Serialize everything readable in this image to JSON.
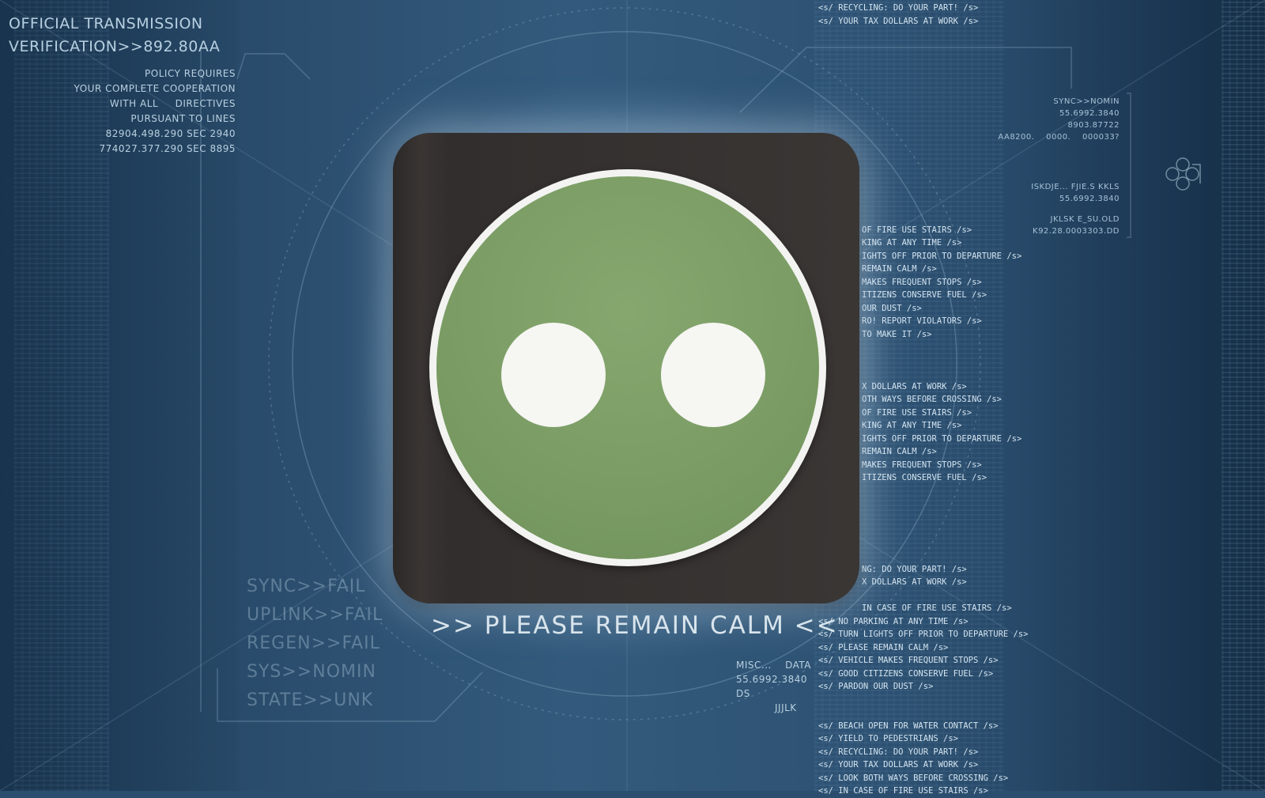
{
  "header": {
    "line1": "OFFICIAL TRANSMISSION",
    "line2": "VERIFICATION>>892.80AA"
  },
  "policy": [
    "POLICY REQUIRES",
    "YOUR COMPLETE COOPERATION",
    "WITH ALL     DIRECTIVES",
    "PURSUANT TO LINES",
    "82904.498.290 SEC 2940",
    "774027.377.290 SEC 8895"
  ],
  "right_panel": {
    "sync": "SYNC>>NOMIN",
    "val1": "55.6992.3840",
    "val2": "8903.87722",
    "codes": "AA8200.    0000.    000033?",
    "iskdje": "ISKDJE... FJIE.S KKLS",
    "val3": "55.6992.3840",
    "jklsk": "JKLSK E_SU.OLD",
    "val4": "K92.28.0003303.DD"
  },
  "status_lines": [
    "SYNC>>FAIL",
    "UPLINK>>FAIL",
    "REGEN>>FAIL",
    "SYS>>NOMIN",
    "STATE>>UNK"
  ],
  "misc": {
    "label": "MISC...    DATA",
    "value": "55.6992.3840",
    "ds": "DS",
    "jjjlk": "JJJLK"
  },
  "banner": ">> PLEASE REMAIN CALM <<",
  "message_stream": [
    "<s/ RECYCLING: DO YOUR PART! /s>",
    "<s/ YOUR TAX DOLLARS AT WORK /s>",
    "",
    "",
    "",
    "",
    "",
    "",
    "",
    "",
    "",
    "",
    "",
    "",
    "",
    "",
    "",
    "OF FIRE USE STAIRS /s>",
    "KING AT ANY TIME /s>",
    "IGHTS OFF PRIOR TO DEPARTURE /s>",
    "REMAIN CALM /s>",
    "MAKES FREQUENT STOPS /s>",
    "ITIZENS CONSERVE FUEL /s>",
    "OUR DUST /s>",
    "RO! REPORT VIOLATORS /s>",
    "TO MAKE IT /s>",
    "",
    "",
    "",
    "X DOLLARS AT WORK /s>",
    "OTH WAYS BEFORE CROSSING /s>",
    "OF FIRE USE STAIRS /s>",
    "KING AT ANY TIME /s>",
    "IGHTS OFF PRIOR TO DEPARTURE /s>",
    "REMAIN CALM /s>",
    "MAKES FREQUENT STOPS /s>",
    "ITIZENS CONSERVE FUEL /s>",
    "",
    "",
    "",
    "",
    "",
    "",
    "NG: DO YOUR PART! /s>",
    "X DOLLARS AT WORK /s>",
    "",
    "IN CASE OF FIRE USE STAIRS /s>",
    "<s/ NO PARKING AT ANY TIME /s>",
    "<s/ TURN LIGHTS OFF PRIOR TO DEPARTURE /s>",
    "<s/ PLEASE REMAIN CALM /s>",
    "<s/ VEHICLE MAKES FREQUENT STOPS /s>",
    "<s/ GOOD CITIZENS CONSERVE FUEL /s>",
    "<s/ PARDON OUR DUST /s>",
    "",
    "",
    "<s/ BEACH OPEN FOR WATER CONTACT /s>",
    "<s/ YIELD TO PEDESTRIANS /s>",
    "<s/ RECYCLING: DO YOUR PART! /s>",
    "<s/ YOUR TAX DOLLARS AT WORK /s>",
    "<s/ LOOK BOTH WAYS BEFORE CROSSING /s>",
    "<s/ IN CASE OF FIRE USE STAIRS /s>"
  ],
  "icons": {
    "app": "robot-face-icon",
    "hex": "hexagon-cluster-icon"
  },
  "colors": {
    "background": "#2c4e6e",
    "face_green": "#7a9c64",
    "tile": "#353130",
    "eyes": "#f6f6f3"
  }
}
